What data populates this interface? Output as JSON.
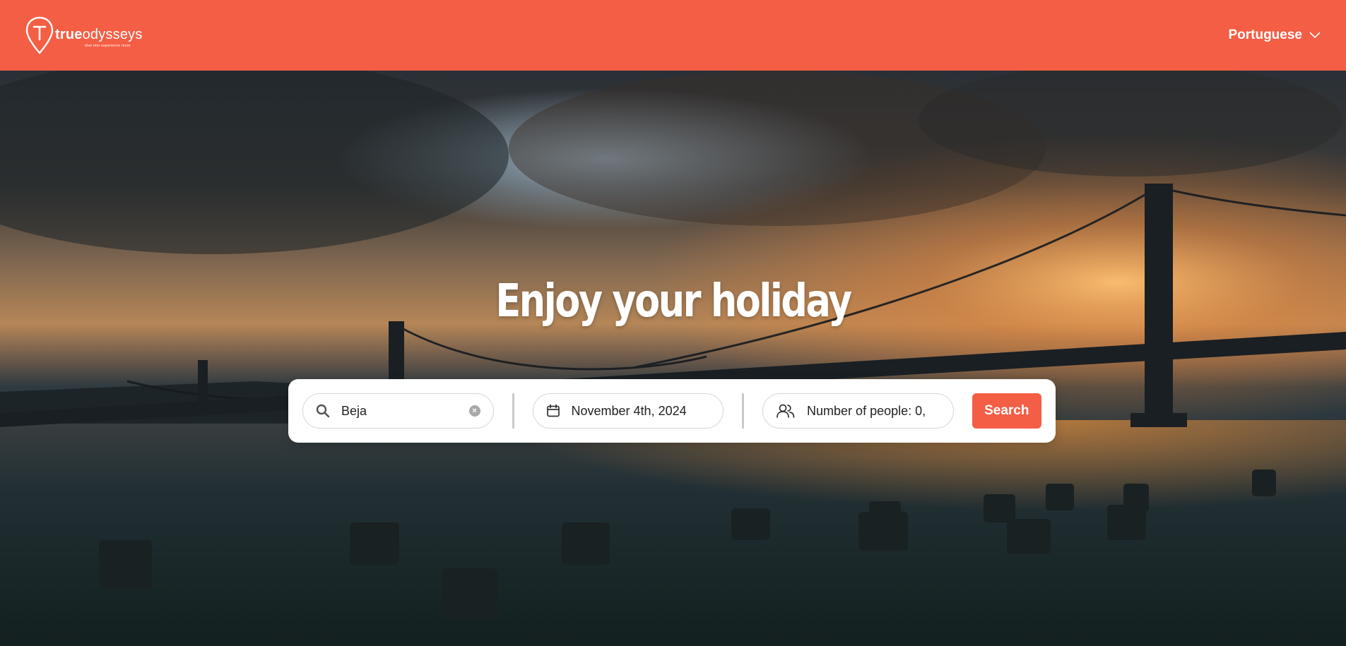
{
  "brand": {
    "name_bold": "true",
    "name_light": "odysseys",
    "tagline": "dive into experience more",
    "color": "#f45e45"
  },
  "header": {
    "language_label": "Portuguese"
  },
  "hero": {
    "headline": "Enjoy your holiday"
  },
  "search": {
    "location_value": "Beja",
    "date_value": "November 4th, 2024",
    "people_value": "Number of people: 0,",
    "button_label": "Search"
  },
  "icons": {
    "location": "search-icon",
    "clear": "clear-icon",
    "date": "calendar-icon",
    "people": "users-icon",
    "language": "chevron-down-icon"
  }
}
